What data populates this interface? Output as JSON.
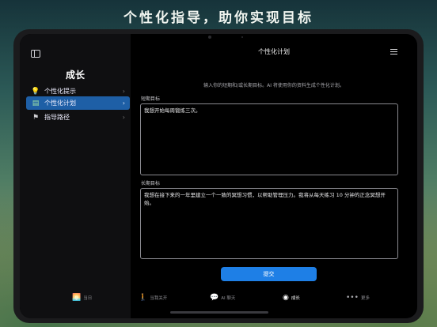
{
  "headline": "个性化指导，助你实现目标",
  "sidebar": {
    "title": "成长",
    "items": [
      {
        "label": "个性化提示",
        "icon": "lightbulb-icon",
        "glyph": "💡",
        "active": false
      },
      {
        "label": "个性化计划",
        "icon": "calendar-icon",
        "glyph": "▤",
        "active": true
      },
      {
        "label": "指导路径",
        "icon": "signpost-icon",
        "glyph": "⚑",
        "active": false
      }
    ]
  },
  "main": {
    "title": "个性化计划",
    "intro": "输入你的短期和/或长期目标。AI 将使用你的资料生成个性化计划。",
    "short_label": "短期目标",
    "short_value": "我想开始每周锻炼三次。",
    "long_label": "长期目标",
    "long_value": "我想在接下来的一年里建立一个一致的冥想习惯，以帮助管理压力。我将从每天练习 10 分钟的正念冥想开始。",
    "submit_label": "提交"
  },
  "tabbar": [
    {
      "label": "当日",
      "icon": "sunrise-icon",
      "glyph": "🌅",
      "active": false
    },
    {
      "label": "当我关开",
      "icon": "walking-icon",
      "glyph": "🚶",
      "active": false
    },
    {
      "label": "AI 聊天",
      "icon": "chat-bubbles-icon",
      "glyph": "💬",
      "active": false
    },
    {
      "label": "成长",
      "icon": "growth-cycle-icon",
      "glyph": "◉",
      "active": true
    },
    {
      "label": "更多",
      "icon": "more-dots-icon",
      "glyph": "•••",
      "active": false
    }
  ]
}
